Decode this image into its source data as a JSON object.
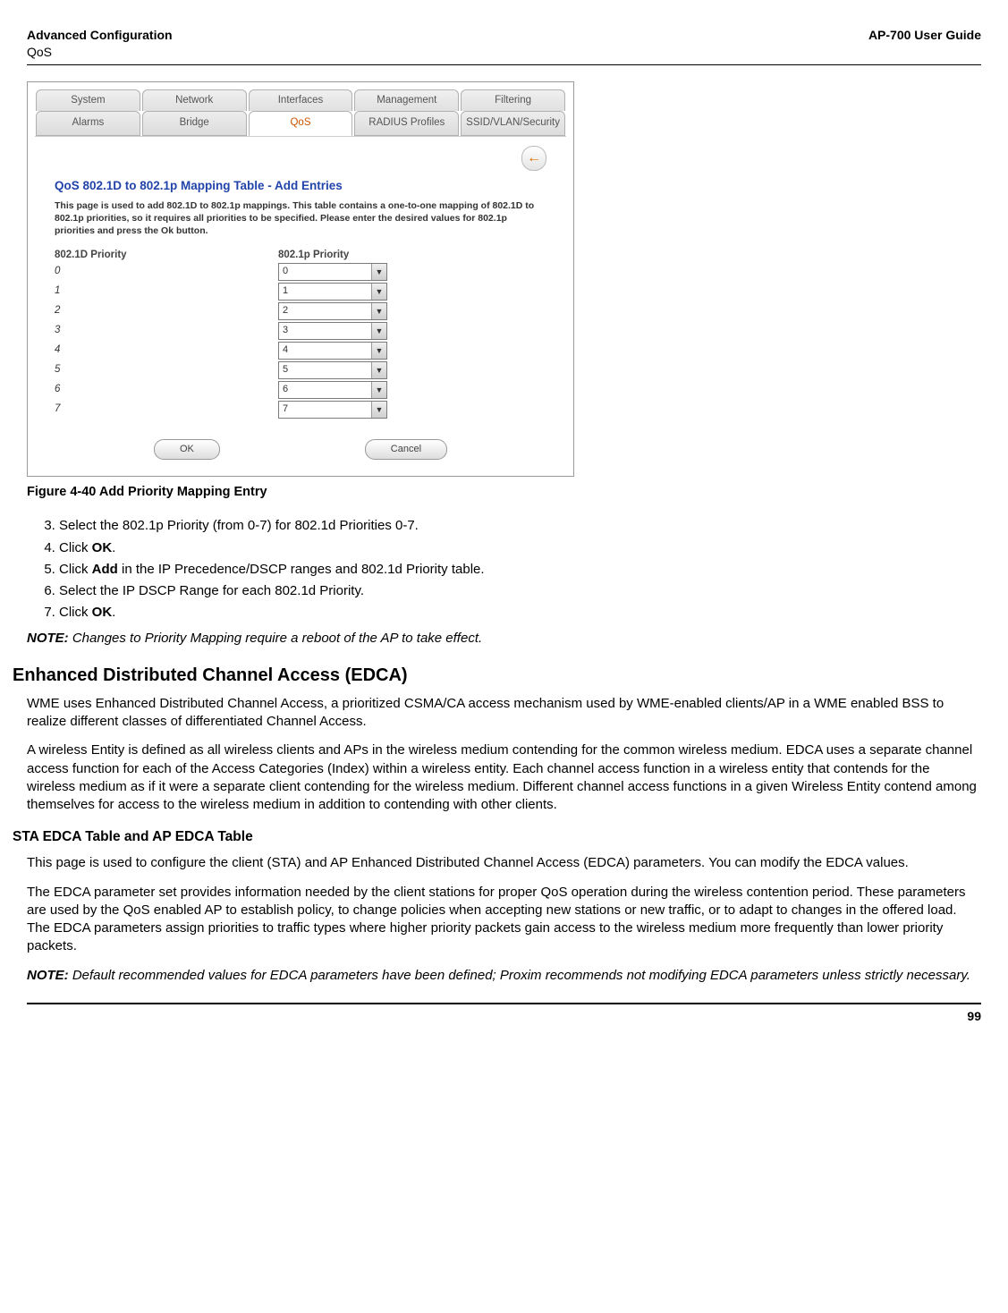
{
  "header": {
    "title": "Advanced Configuration",
    "subtitle": "QoS",
    "guide": "AP-700 User Guide"
  },
  "tabs1": {
    "a": "System",
    "b": "Network",
    "c": "Interfaces",
    "d": "Management",
    "e": "Filtering"
  },
  "tabs2": {
    "a": "Alarms",
    "b": "Bridge",
    "c": "QoS",
    "d": "RADIUS Profiles",
    "e": "SSID/VLAN/Security"
  },
  "back_glyph": "←",
  "panel": {
    "title": "QoS 802.1D to 802.1p Mapping Table - Add Entries",
    "desc": "This page is used to add 802.1D to 802.1p mappings. This table contains a one-to-one mapping of 802.1D to 802.1p priorities, so it requires all priorities to be specified. Please enter the desired values for 802.1p priorities and press the Ok button.",
    "colA": "802.1D Priority",
    "colB": "802.1p Priority"
  },
  "rows": {
    "r0l": "0",
    "r0v": "0",
    "r1l": "1",
    "r1v": "1",
    "r2l": "2",
    "r2v": "2",
    "r3l": "3",
    "r3v": "3",
    "r4l": "4",
    "r4v": "4",
    "r5l": "5",
    "r5v": "5",
    "r6l": "6",
    "r6v": "6",
    "r7l": "7",
    "r7v": "7"
  },
  "buttons": {
    "ok": "OK",
    "cancel": "Cancel"
  },
  "fig_caption": "Figure 4-40 Add Priority Mapping Entry",
  "steps": {
    "s3": "Select the 802.1p Priority (from 0-7) for 802.1d Priorities 0-7.",
    "s4a": "Click ",
    "s4b": "OK",
    "s4c": ".",
    "s5a": "Click ",
    "s5b": "Add",
    "s5c": " in the IP Precedence/DSCP ranges and 802.1d Priority table.",
    "s6": "Select the IP DSCP Range for each 802.1d Priority.",
    "s7a": "Click ",
    "s7b": "OK",
    "s7c": "."
  },
  "note1": {
    "label": "NOTE:",
    "text": "Changes to Priority Mapping require a reboot of the AP to take effect."
  },
  "edca": {
    "title": "Enhanced Distributed Channel Access (EDCA)",
    "p1": "WME uses Enhanced Distributed Channel Access, a prioritized CSMA/CA access mechanism used by WME-enabled clients/AP in a WME enabled BSS to realize different classes of differentiated Channel Access.",
    "p2": "A wireless Entity is defined as all wireless clients and APs in the wireless medium contending for the common wireless medium. EDCA uses a separate channel access function for each of the Access Categories (Index) within a wireless entity. Each channel access function in a wireless entity that contends for the wireless medium as if it were a separate client contending for the wireless medium. Different channel access functions in a given Wireless Entity contend among themselves for access to the wireless medium in addition to contending with other clients."
  },
  "sta": {
    "title": "STA EDCA Table and AP EDCA Table",
    "p1": "This page is used to configure the client (STA) and AP Enhanced Distributed Channel Access (EDCA) parameters. You can modify the EDCA values.",
    "p2": "The EDCA parameter set provides information needed by the client stations for proper QoS operation during the wireless contention period. These parameters are used by the QoS enabled AP to establish policy, to change policies when accepting new stations or new traffic, or to adapt to changes in the offered load. The EDCA parameters assign priorities to traffic types where higher priority packets gain access to the wireless medium more frequently than lower priority packets."
  },
  "note2": {
    "label": "NOTE:",
    "text": "Default recommended values for EDCA parameters have been defined; Proxim recommends not modifying EDCA parameters unless strictly necessary."
  },
  "page_number": "99"
}
